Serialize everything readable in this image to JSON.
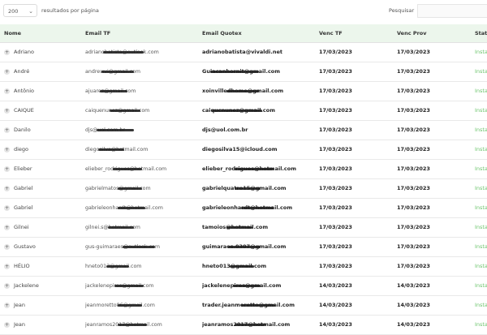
{
  "controls": {
    "page_size": "200",
    "per_page_label": "resultados por página",
    "search_label": "Pesquisar",
    "search_value": ""
  },
  "columns": [
    "Nome",
    "Email TF",
    "Email Quotex",
    "Venc TF",
    "Venc Prov",
    "Status"
  ],
  "rows": [
    {
      "name": "Adriano",
      "email_tf": "adrianobatista@outlook.com",
      "email_quotex": "adrianobatista@vivaldi.net",
      "venc_tf": "17/03/2023",
      "venc_prov": "17/03/2023",
      "status": "Insta"
    },
    {
      "name": "André",
      "email_tf": "andrewvi@gmail.com",
      "email_quotex": "Guiacanhornit@gmail.com",
      "venc_tf": "17/03/2023",
      "venc_prov": "17/03/2023",
      "status": "Insta"
    },
    {
      "name": "Antônio",
      "email_tf": "ajuarez@gmail.com",
      "email_quotex": "xoinvilledhome@gmail.com",
      "venc_tf": "17/03/2023",
      "venc_prov": "17/03/2023",
      "status": "Insta"
    },
    {
      "name": "CAIQUE",
      "email_tf": "caiquenunez@gmail.com",
      "email_quotex": "caiqucnunez@gmail.com",
      "venc_tf": "17/03/2023",
      "venc_prov": "17/03/2023",
      "status": "Insta"
    },
    {
      "name": "Danilo",
      "email_tf": "djs@uol.com.br",
      "email_quotex": "djs@uol.com.br",
      "venc_tf": "17/03/2023",
      "venc_prov": "17/03/2023",
      "status": "Insta"
    },
    {
      "name": "diego",
      "email_tf": "diegosilva@hotmail.com",
      "email_quotex": "diegosilva15@icloud.com",
      "venc_tf": "17/03/2023",
      "venc_prov": "17/03/2023",
      "status": "Insta"
    },
    {
      "name": "Elieber",
      "email_tf": "elieber_rodrigues@hotmail.com",
      "email_quotex": "elieber_rodrigues@hotmail.com",
      "venc_tf": "17/03/2023",
      "venc_prov": "17/03/2023",
      "status": "Insta"
    },
    {
      "name": "Gabriel",
      "email_tf": "gabrielmatos@gmail.com",
      "email_quotex": "gabrielquatro15@gmail.com",
      "venc_tf": "17/03/2023",
      "venc_prov": "17/03/2023",
      "status": "Insta"
    },
    {
      "name": "Gabriel",
      "email_tf": "gabrieleonhardt@hotmail.com",
      "email_quotex": "gabrieleonhardt@hotmail.com",
      "venc_tf": "17/03/2023",
      "venc_prov": "17/03/2023",
      "status": "Insta"
    },
    {
      "name": "Gilnei",
      "email_tf": "gilnei.s@hotmail.com",
      "email_quotex": "tamoios@hotmail.com",
      "venc_tf": "17/03/2023",
      "venc_prov": "17/03/2023",
      "status": "Insta"
    },
    {
      "name": "Gustavo",
      "email_tf": "gus-guimaraes@outlook.com",
      "email_quotex": "guimaraes.0307@gmail.com",
      "venc_tf": "17/03/2023",
      "venc_prov": "17/03/2023",
      "status": "Insta"
    },
    {
      "name": "HÉLIO",
      "email_tf": "hneto013@gmail.com",
      "email_quotex": "hneto013@gmail.com",
      "venc_tf": "17/03/2023",
      "venc_prov": "17/03/2023",
      "status": "Insta"
    },
    {
      "name": "Jackelene",
      "email_tf": "jackelenepires@gmail.com",
      "email_quotex": "jackelenepires@gmail.com",
      "venc_tf": "14/03/2023",
      "venc_prov": "14/03/2023",
      "status": "Insta"
    },
    {
      "name": "Jean",
      "email_tf": "jeanmoretto86@gmail.com",
      "email_quotex": "trader.jeanmoretto@gmail.com",
      "venc_tf": "14/03/2023",
      "venc_prov": "14/03/2023",
      "status": "Insta"
    },
    {
      "name": "Jean",
      "email_tf": "jeanramos2017@hotmail.com",
      "email_quotex": "jeanramos2017@hotmail.com",
      "venc_tf": "14/03/2023",
      "venc_prov": "14/03/2023",
      "status": "Insta"
    }
  ]
}
